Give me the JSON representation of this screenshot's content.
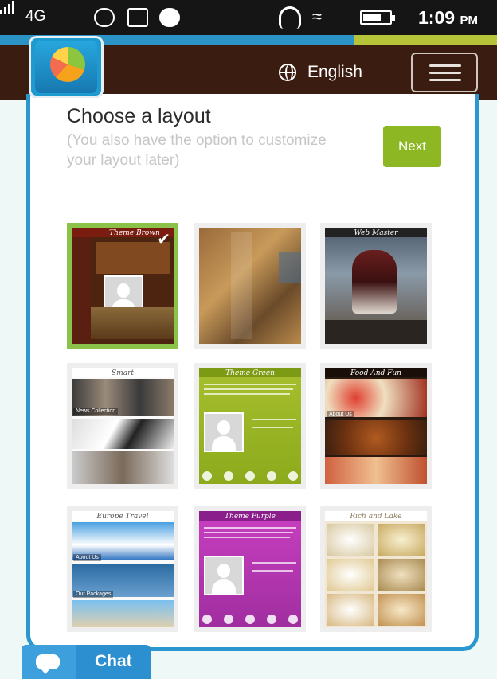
{
  "status_bar": {
    "network": "4G",
    "time": "1:09",
    "ampm": "PM"
  },
  "header": {
    "language": "English"
  },
  "main": {
    "title": "Choose a layout",
    "subtitle": "(You also have the option to customize your layout later)",
    "next_label": "Next"
  },
  "layouts": [
    {
      "title": "Theme Brown",
      "selected": true
    },
    {
      "title": "",
      "selected": false
    },
    {
      "title": "Web Master",
      "selected": false
    },
    {
      "title": "Smart",
      "selected": false
    },
    {
      "title": "Theme Green",
      "selected": false
    },
    {
      "title": "Food And Fun",
      "selected": false
    },
    {
      "title": "Europe Travel",
      "selected": false
    },
    {
      "title": "Theme Purple",
      "selected": false
    },
    {
      "title": "Rich and Lake",
      "selected": false
    }
  ],
  "thumb_labels": {
    "about_us": "About Us",
    "news": "News Collection",
    "packages": "Our Packages"
  },
  "chat": {
    "label": "Chat"
  },
  "colors": {
    "header_bg": "#3b1c10",
    "accent_blue": "#2a97cf",
    "next_green": "#8db824",
    "selected_border": "#8bc34a"
  }
}
